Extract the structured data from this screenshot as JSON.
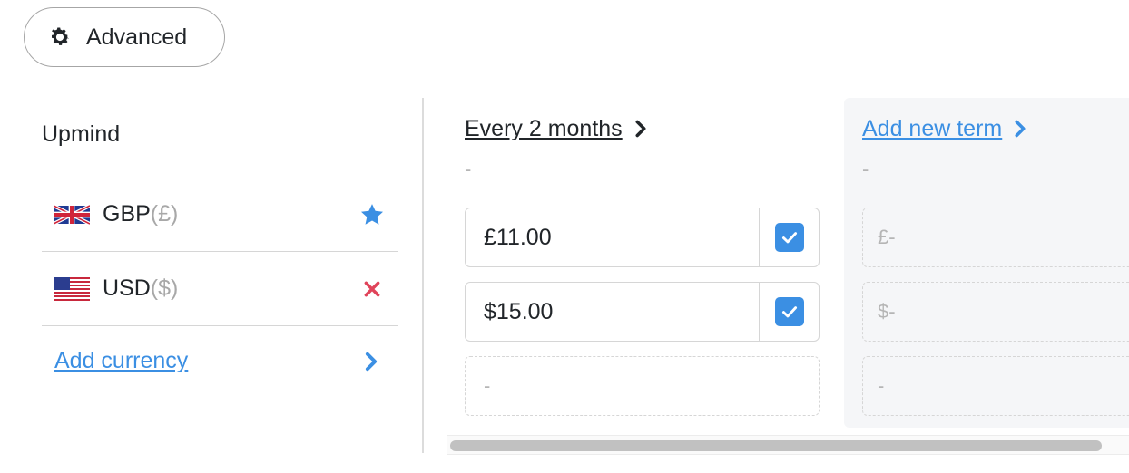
{
  "toolbar": {
    "advanced_label": "Advanced",
    "advanced_icon": "gear-icon"
  },
  "product": {
    "name": "Upmind"
  },
  "currencies": [
    {
      "code": "GBP",
      "symbol": "(£)",
      "flag": "uk-flag-icon",
      "action": "star-icon",
      "action_color": "#3b8fe3"
    },
    {
      "code": "USD",
      "symbol": "($)",
      "flag": "us-flag-icon",
      "action": "close-icon",
      "action_color": "#e0445a"
    }
  ],
  "add_currency": {
    "label": "Add currency",
    "icon": "chevron-right-icon"
  },
  "term": {
    "title": "Every 2 months",
    "subtitle": "-",
    "prices": [
      {
        "value": "£11.00",
        "checked": true
      },
      {
        "value": "$15.00",
        "checked": true
      }
    ],
    "empty_placeholder": "-"
  },
  "new_term": {
    "title": "Add new term",
    "subtitle": "-",
    "placeholders": [
      "£-",
      "$-",
      "-"
    ]
  },
  "colors": {
    "accent": "#3b8fe3",
    "danger": "#e0445a",
    "muted": "#b5b5b5"
  }
}
